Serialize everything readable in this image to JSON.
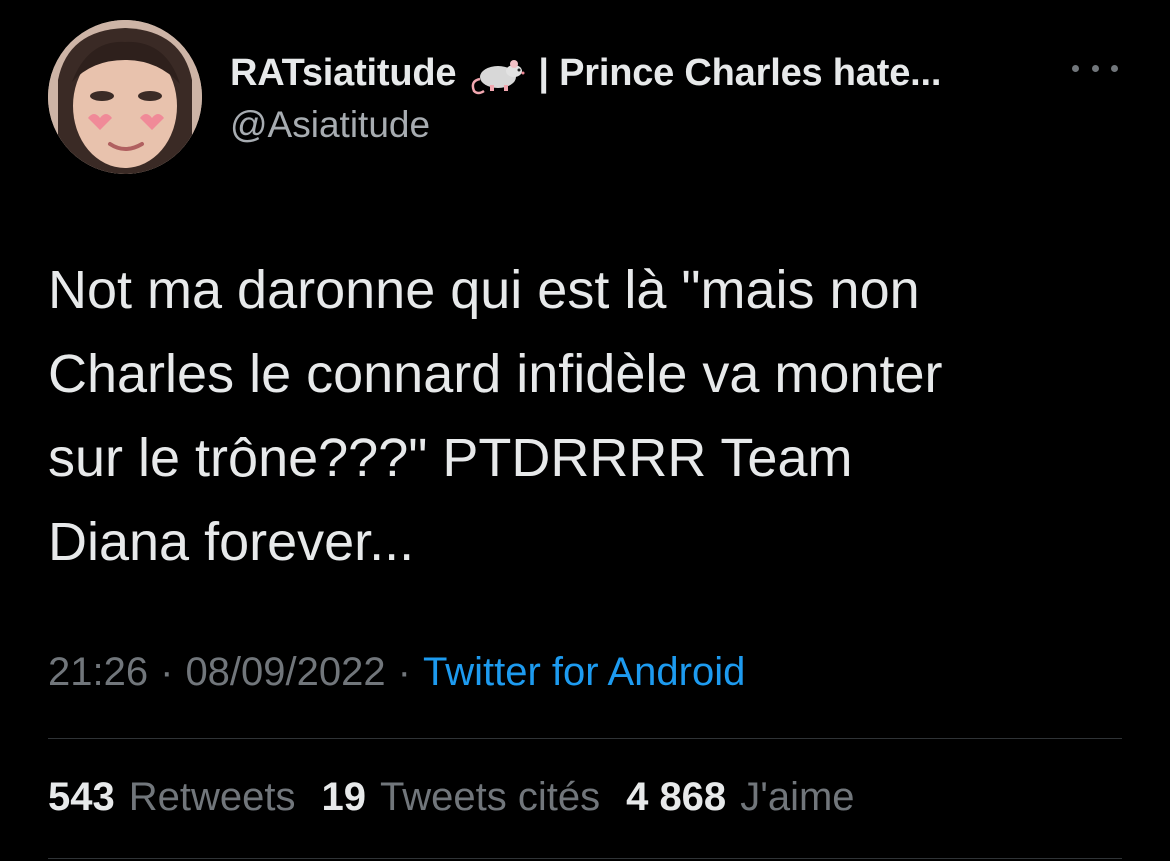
{
  "author": {
    "display_name": "RATsiatitude",
    "display_name_suffix": "| Prince Charles hate...",
    "name_emoji_icon": "rat-icon",
    "handle": "@Asiatitude",
    "avatar_icon": "profile-photo"
  },
  "more_icon": "ellipsis-horizontal-icon",
  "tweet": {
    "text": "Not ma daronne qui est là \"mais non\nCharles le connard infidèle va monter\nsur le trône???\" PTDRRRR Team\nDiana forever..."
  },
  "meta": {
    "time": "21:26",
    "separator_1": "·",
    "date": "08/09/2022",
    "separator_2": "·",
    "source": "Twitter for Android"
  },
  "stats": {
    "retweets": {
      "count": "543",
      "label": "Retweets"
    },
    "quotes": {
      "count": "19",
      "label": "Tweets cités"
    },
    "likes": {
      "count": "4 868",
      "label": "J'aime"
    }
  },
  "colors": {
    "background": "#000000",
    "primary_text": "#e7e9ea",
    "secondary_text": "#71767b",
    "link": "#1d9bf0",
    "divider": "#2f3336"
  }
}
